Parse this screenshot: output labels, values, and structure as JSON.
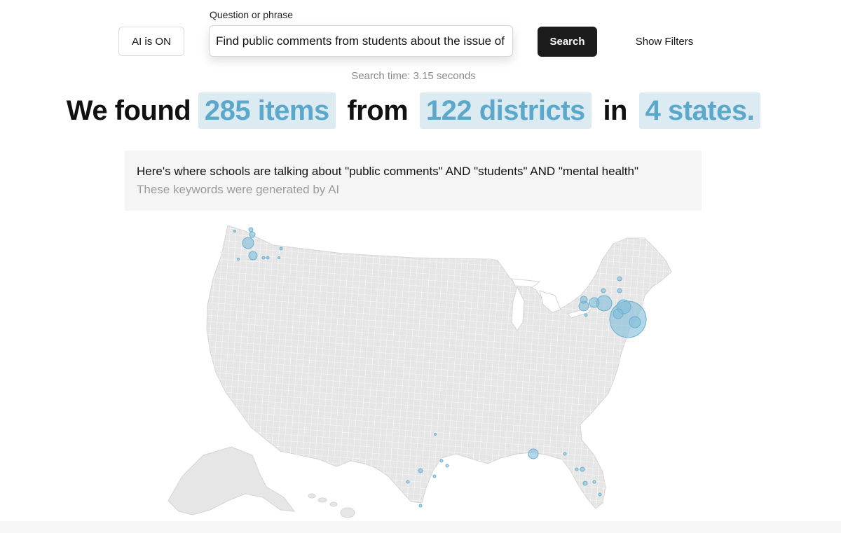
{
  "toolbar": {
    "ai_toggle_label": "AI is ON",
    "question_label": "Question or phrase",
    "question_value": "Find public comments from students about the issue of mental health",
    "search_label": "Search",
    "filters_label": "Show Filters"
  },
  "search_time": "Search time: 3.15 seconds",
  "headline": {
    "prefix": "We found",
    "items": "285 items",
    "from": "from",
    "districts": "122 districts",
    "in": "in",
    "states": "4 states."
  },
  "keywords": {
    "text": "Here's where schools are talking about \"public comments\" AND \"students\" AND \"mental health\"",
    "note": "These keywords were generated by AI"
  },
  "colors": {
    "accent": "#5ba8cb",
    "highlight_bg": "#dcebf2",
    "map_fill": "#e6e6e6",
    "bubble": "#7fbcd9"
  }
}
